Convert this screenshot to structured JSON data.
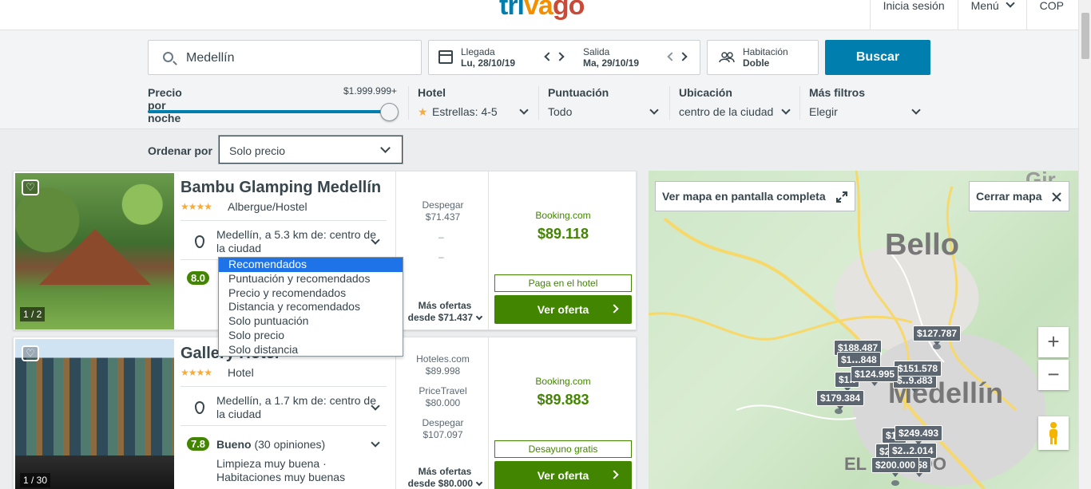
{
  "header": {
    "logo": {
      "t1": "tri",
      "t2": "va",
      "t3": "go"
    },
    "nav": {
      "login": "Inicia sesión",
      "menu": "Menú",
      "currency": "COP"
    }
  },
  "search": {
    "destination": "Medellín",
    "checkin_label": "Llegada",
    "checkin_value": "Lu, 28/10/19",
    "checkout_label": "Salida",
    "checkout_value": "Ma, 29/10/19",
    "room_label": "Habitación",
    "room_value": "Doble",
    "button": "Buscar"
  },
  "filters": {
    "price_label": "Precio por noche",
    "price_max": "$1.999.999+",
    "price_level": 1.0,
    "hotel_label": "Hotel",
    "hotel_value": "Estrellas: 4-5",
    "score_label": "Puntuación",
    "score_value": "Todo",
    "location_label": "Ubicación",
    "location_value": "centro de la ciudad",
    "more_label": "Más filtros",
    "more_value": "Elegir"
  },
  "sort": {
    "label": "Ordenar por",
    "value": "Solo precio",
    "options": [
      "Recomendados",
      "Puntuación y recomendados",
      "Precio y recomendados",
      "Distancia y recomendados",
      "Solo puntuación",
      "Solo precio",
      "Solo distancia"
    ],
    "highlighted": "Recomendados"
  },
  "hotels": [
    {
      "name": "Bambu Glamping Medellín",
      "stars": "★★★★",
      "type": "Albergue/Hostel",
      "location": "Medellín, a 5.3 km de: centro de la ciudad",
      "rating": "8.0",
      "photo_count": "1 / 2",
      "partners": [
        {
          "site": "Despegar",
          "price": "$71.437"
        }
      ],
      "dash1": "–",
      "dash2": "–",
      "more_offers": "Más ofertas",
      "more_from": "desde $71.437",
      "best_site": "Booking.com",
      "best_price": "$89.118",
      "tag": "Paga en el hotel",
      "cta": "Ver oferta"
    },
    {
      "name": "Gallery Hotel",
      "stars": "★★★★",
      "type": "Hotel",
      "location": "Medellín, a 1.7 km de: centro de la ciudad",
      "rating": "7.8",
      "rating_word": "Bueno",
      "rating_count": "(30 opiniones)",
      "highlights": "Limpieza muy buena · Habitaciones muy buenas",
      "photo_count": "1 / 30",
      "partners": [
        {
          "site": "Hoteles.com",
          "price": "$89.998"
        },
        {
          "site": "PriceTravel",
          "price": "$80.000"
        },
        {
          "site": "Despegar",
          "price": "$107.097"
        }
      ],
      "more_offers": "Más ofertas",
      "more_from": "desde $80.000",
      "best_site": "Booking.com",
      "best_price": "$89.883",
      "tag": "Desayuno gratis",
      "cta": "Ver oferta"
    }
  ],
  "map": {
    "fullscreen_button": "Ver mapa en pantalla completa",
    "close_button": "Cerrar mapa",
    "label_bello": "Bello",
    "label_medellin": "Medellín",
    "label_el": "EL",
    "label_do": "DO",
    "label_gir": "Gir",
    "zoom_in": "+",
    "zoom_out": "−",
    "price_pins": [
      "$127.787",
      "$188.487",
      "$1‥.848",
      "$124.995",
      "$151.578",
      "$1‥",
      "$‥9.883",
      "$179.384",
      "$1‥",
      "$249.493",
      "$2‥",
      "$2‥2.014",
      "$200.000",
      "‥58"
    ]
  },
  "colors": {
    "brand_blue": "#007faf",
    "deal_green": "#428500",
    "star_orange": "#f6ab3f",
    "selection_blue": "#1e73e8"
  }
}
